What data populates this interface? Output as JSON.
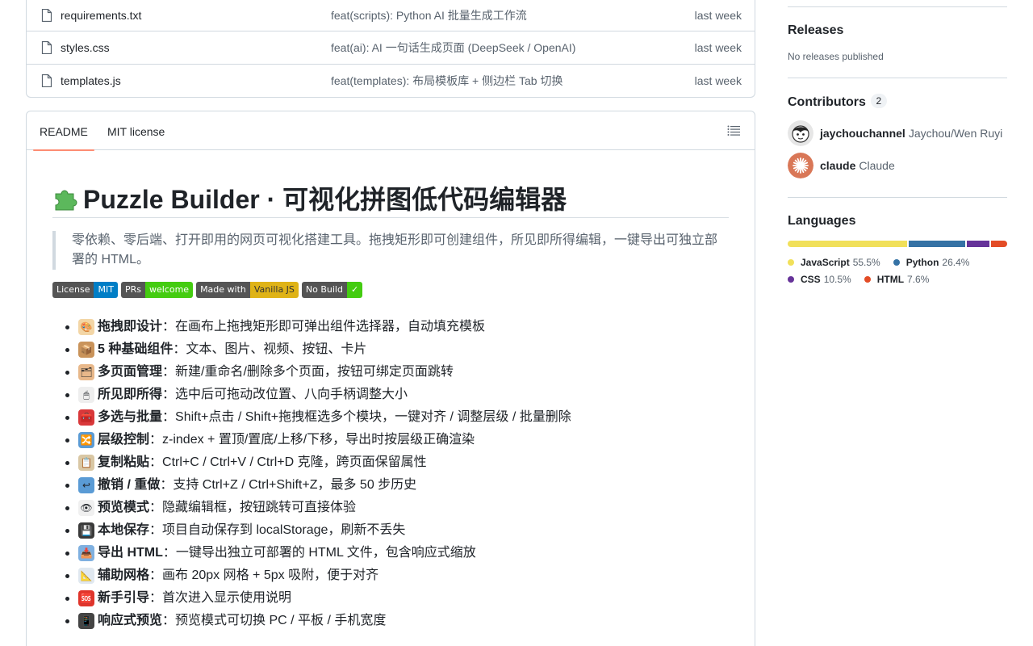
{
  "files": [
    {
      "name": "requirements.txt",
      "message": "feat(scripts): Python AI 批量生成工作流",
      "date": "last week"
    },
    {
      "name": "styles.css",
      "message": "feat(ai): AI 一句话生成页面 (DeepSeek / OpenAI)",
      "date": "last week"
    },
    {
      "name": "templates.js",
      "message": "feat(templates): 布局模板库 + 侧边栏 Tab 切换",
      "date": "last week"
    }
  ],
  "readme": {
    "tabs": [
      "README",
      "MIT license"
    ],
    "title": "Puzzle Builder · 可视化拼图低代码编辑器",
    "title_icon": "puzzle-piece-icon",
    "description": "零依赖、零后端、打开即用的网页可视化搭建工具。拖拽矩形即可创建组件，所见即所得编辑，一键导出可独立部署的 HTML。",
    "badges": [
      {
        "left": "License",
        "right": "MIT",
        "color": "#007ec6"
      },
      {
        "left": "PRs",
        "right": "welcome",
        "color": "#4c1"
      },
      {
        "left": "Made with",
        "right": "Vanilla JS",
        "color": "#dfb317",
        "dark_text": true
      },
      {
        "left": "No Build",
        "right": "✓",
        "color": "#4c1"
      }
    ],
    "features": [
      {
        "emoji": "🎨",
        "icon": "palette-icon",
        "bg": "#f3d6a6",
        "title": "拖拽即设计",
        "text": "：在画布上拖拽矩形即可弹出组件选择器，自动填充模板"
      },
      {
        "emoji": "📦",
        "icon": "package-icon",
        "bg": "#c9935a",
        "title": "5 种基础组件",
        "text": "：文本、图片、视频、按钮、卡片"
      },
      {
        "emoji": "🗂",
        "icon": "card-index-dividers-icon",
        "bg": "#e8b88a",
        "title": "多页面管理",
        "text": "：新建/重命名/删除多个页面，按钮可绑定页面跳转"
      },
      {
        "emoji": "🖱",
        "icon": "mouse-icon",
        "bg": "#eeeeee",
        "title": "所见即所得",
        "text": "：选中后可拖动改位置、八向手柄调整大小"
      },
      {
        "emoji": "🧰",
        "icon": "toolbox-icon",
        "bg": "#d9383a",
        "title": "多选与批量",
        "text": "：Shift+点击 / Shift+拖拽框选多个模块，一键对齐 / 调整层级 / 批量删除"
      },
      {
        "emoji": "🔀",
        "icon": "shuffle-icon",
        "bg": "#5a9bd5",
        "title": "层级控制",
        "text": "：z-index + 置顶/置底/上移/下移，导出时按层级正确渲染"
      },
      {
        "emoji": "📋",
        "icon": "clipboard-icon",
        "bg": "#d9c7a4",
        "title": "复制粘贴",
        "text": "：Ctrl+C / Ctrl+V / Ctrl+D 克隆，跨页面保留属性"
      },
      {
        "emoji": "↩",
        "icon": "undo-arrow-icon",
        "bg": "#5a9bd5",
        "title": "撤销 / 重做",
        "text": "：支持 Ctrl+Z / Ctrl+Shift+Z，最多 50 步历史"
      },
      {
        "emoji": "👁",
        "icon": "eye-icon",
        "bg": "#f0f0f0",
        "title": "预览模式",
        "text": "：隐藏编辑框，按钮跳转可直接体验"
      },
      {
        "emoji": "💾",
        "icon": "floppy-disk-icon",
        "bg": "#3a3a3a",
        "title": "本地保存",
        "text": "：项目自动保存到 localStorage，刷新不丢失"
      },
      {
        "emoji": "📥",
        "icon": "inbox-tray-icon",
        "bg": "#7fb0e0",
        "title": "导出 HTML",
        "text": "：一键导出独立可部署的 HTML 文件，包含响应式缩放"
      },
      {
        "emoji": "📐",
        "icon": "triangular-ruler-icon",
        "bg": "#e0e8f0",
        "title": "辅助网格",
        "text": "：画布 20px 网格 + 5px 吸附，便于对齐"
      },
      {
        "emoji": "🆘",
        "icon": "sos-icon",
        "bg": "#e0352b",
        "title": "新手引导",
        "text": "：首次进入显示使用说明"
      },
      {
        "emoji": "📱",
        "icon": "mobile-phone-icon",
        "bg": "#444444",
        "title": "响应式预览",
        "text": "：预览模式可切换 PC / 平板 / 手机宽度"
      }
    ]
  },
  "sidebar": {
    "releases": {
      "title": "Releases",
      "text": "No releases published"
    },
    "contributors": {
      "title": "Contributors",
      "count": "2",
      "people": [
        {
          "login": "jaychouchannel",
          "full": "Jaychou/Wen Ruyi"
        },
        {
          "login": "claude",
          "full": "Claude"
        }
      ]
    },
    "languages": {
      "title": "Languages",
      "items": [
        {
          "name": "JavaScript",
          "pct": "55.5%",
          "value": 55.5,
          "color": "#f1e05a"
        },
        {
          "name": "Python",
          "pct": "26.4%",
          "value": 26.4,
          "color": "#3572A5"
        },
        {
          "name": "CSS",
          "pct": "10.5%",
          "value": 10.5,
          "color": "#663399"
        },
        {
          "name": "HTML",
          "pct": "7.6%",
          "value": 7.6,
          "color": "#e34c26"
        }
      ]
    }
  }
}
